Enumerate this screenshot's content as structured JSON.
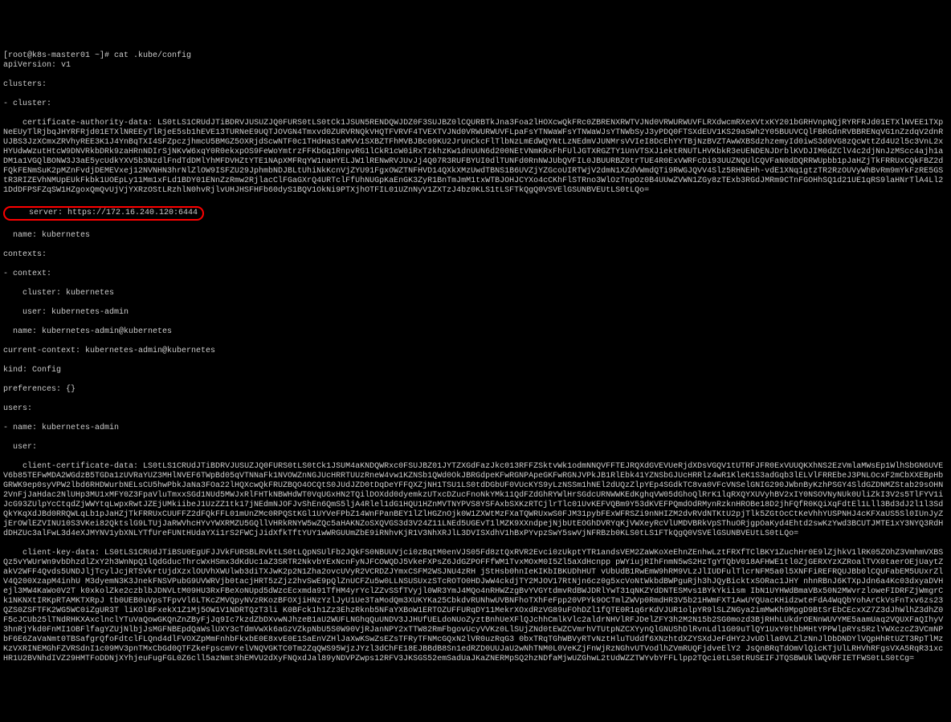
{
  "prompt": "[root@k8s-master01 ~]# ",
  "command": "cat .kube/config",
  "config": {
    "apiVersion": "apiVersion: v1",
    "clusters_header": "clusters:",
    "cluster_item": "- cluster:",
    "cert_auth_label": "    certificate-authority-data: ",
    "cert_auth_data": "LS0tLS1CRUdJTiBDRVJUSUZJQ0FURS0tLS0tCk1JSUN5RENDQWJDZ0F3SUJBZ0lCQURBTkJna3Foa2lHOXcwQkFRc0ZBRENXRWTVJNd0VRWURWUVFLRXdwcmRXeXVtxKY201bGRHVnpNQjRYRFRJd01ETXlNVEE1TXpNeEUyTlRjbqJHYRFRjd01ETXlNREEyTlRjeE5sb1hEVE13TURNeE9UQTJOVGN4Tmxvd0ZURVRNQkVHQTFVRVF4TVEXTVJNd0VRWURWUVFLpaFsYTNWaWFsYTNWaWJsYTNWbSyJ3yPDQ0FTSXdEUV1KS29aSWh2Y05BUUVCQlFBRGdnRVBBRENqVG1nZzdqV2dnRUJBS3JzXCmxZRVhyREE3K1J4YnBqTXI4SFZpczjhmcU5BMGZ5OXRjdScwNTF0c1THdHaStaMVV1SXBZTFhMVBJBc09KU2JrUnCkcFlTlbNzLmEdWQYNtLzNEdmVJUNMrsVVIeI8DcEhYYTBjNzBVZTAwWXBSdzhzemyId0iwS3d0VG8zQcWttZd4U2l5c3VnL2xHYUdwWzutHtcW9DNVRkbDRk9zaHRnNDIrSjNKvW6xqY0R0ekxpOS9FeWoYmtrzFFKbGq1RnpvRG1lCkR1cW0iRxTzkhzKw1dnUUN6d200NEtVNmKRxFhFUlJGTXRGZTY1UnVTSXJiektRNUTLHVKbkR3eUENDENJDrblKVDJIM0dZClV4c2djNnJzMScc4ajh1aDM1a1VGQlBONW3J3aE5ycUdkYXV5b3NzdlFndTdDMlYhMFDVHZtYTE1NApXMFRqYW1naHYELJW1lRENwRVJUvJj4Q07R3RUFBYUI0dlTUNFd0RnNWJUbQVFIL0JBUURBZ0trTUE4R0ExVWRFcDi93UUZNQUlCQVFaN0dDQRRWUpbb1pJaHZjTkFRRUxCQkFBZ2dFQkFENmSuK2pMZnFvdjDEMEVxej12NVNHN3hrNlZlOW9ISFZU29JphmbNDJBLtUhiNkKcnVjZYU91FgxOWZTNFHVD14QXkXMzUwdTBNS1B6UVZjYZGcoUIRTWjV2dmN1XZdVWmdQTi9RWGJQVV4Slz5RHNEHh-vdE1XNq1gtzTR2RzOUVyWhBvRm9mYkFzRE5GStR3RIZEVhNMUpEUkFkbk1UOEpLy11Mm1xFLd1BDY01ENnZzRmw2RjlacClFGaGXrQ4URTclFfUhNUGpKaEnGK3ZyR1BnTmJmM1txWTBJOHJCYXo4cCKhFlSTRno3WlOzTnpOz0B4UUwZVWN1ZGy8zTExb3RGdJMRm9CTnFGOHhSQ1d21UE1qRS9laHNrTlA4Ll21DdDFPSFZqSW1HZgoxQmQvUjVjYXRzOStLRzhlN0hvRjlvUHJHSFHFb60dyS1BQV1OkNi9PTXjhOTFIL01UZnNyV1ZXTzJ4bz0KLS1tLSFTkQgQ0VSVElGSUNBVEUtLS0tLQo=",
    "server_label": "    server: ",
    "server_value": "https://172.16.240.120:6444",
    "name_kubernetes": "  name: kubernetes",
    "contexts_header": "contexts:",
    "context_item": "- context:",
    "cluster_kubernetes": "    cluster: kubernetes",
    "user_admin": "    user: kubernetes-admin",
    "name_admin_ctx": "  name: kubernetes-admin@kubernetes",
    "current_context": "current-context: kubernetes-admin@kubernetes",
    "kind": "kind: Config",
    "preferences": "preferences: {}",
    "users_header": "users:",
    "user_item": "- name: kubernetes-admin",
    "user_sub": "  user:",
    "client_cert_label": "    client-certificate-data: ",
    "client_cert_data": "LS0tLS1CRUdJTiBDRVJUSUZJQ0FURS0tLS0tCk1JSUM4aKNDQWRxc0FSUJBZ01JYTZXGdFazJkc013RFFZSktvWk1odmNNQVFFTEJRQXdGVEVUeRjdXDsVGQV1tUTRFJFR0ExVUUQKXhNS2EzVmlaMWsEp1WlhSbGN6UVEV6b85TEFwMDA2WGdzB5TGDa1zUVRaYUZ3MHlNVEF6TWpBd05qVTNNaFk1NVOWZnNGJUcHRRTUUzRneW4vw1KZNSb1QWd0OkJBRGdpeKFwRGNPApeGKFwRGNJVPkJB1RlEbk41YZNSbGJUcHRRlz4wR1KleK1S3adGqb3lELVlFRREbeJ3PNLOcxF2mCbXXEBpHbGRWK9ep0syVPW2lbd6RHDWurbNELsCU5hwPbkJaNa3FOa22lHQXcwQkFRUZBQO4OCQtS0JUdJZD0tDqDeYFFQXZjNH1TSU1LS0tdDGbUF0VUcKYS9yLzNSSm1hNEl2dUQzZlpYEp4SGdkTC8va0VFcVNSelGNIG290JWbnByKzhPSGY4SldGZDNMZStab29sOHN2VnFjJaHdac2NlUHp3MU1xMFY0Z3FpaVluTmxxSGd1NUd5MWJxRlFHTkNBWHdWT0VqUGxHN2TQilDOXdd0dyemkzUTxcDZucFnoNkYMk11QdFZdGhRYWlHrSGdcURNWWKEdKghqVW05dGhoQlRrK1lqRXQYXUVyhBV2xIY0NSOVNyNUk0UliZkI3V2s5TlFYV1iJcG93ZUlpYcCtqdZjWWYtqLwpxRwtJZEjUMkiibeJ1UzZZ1tk17jNEdmNJOFJvShEn6QmS5ljA4Rlel1dG1HQU1HZnMVTNYPVS8YSFAxbSXKzRTCjlrTlc01UvKEFVQBm9Y53dKVEFPQmdOdRMynRzknHROBe18D2jhFQfR0KQiXqFdtEl1Lll3Bd3dJ2l1l3SdQkYKqXdJBd0RRQWLqLb1pJaHZjTkFRRUxCUUFFZ2dFQkFFL01mUnZMc0RPQStKGl1UYVeFPbZ14WnFPanBEY1lZlHGZnOjk0W1ZXWtMzFXaTQWRUxwS0FJM31pybFExWFRSZi9nNHIZM2dvRVdNTKtU2pjTlk5ZGtOcCtKeVhhYUSPNHJ4cKFXaUS5Sl0IUnJyZjErOWlEZVINU10S3VKei82QktslG9LTUjJaRWVhcHYvYWXRMZU5GQllVHRkRNYW5wZQc5aHAKNZoSXQVGS3d3V24Z11LNEd5UGEvT1lMZK9XXndpejNjbUtEOGhDVRYqKjVWXeyRcVlUMDVBRkVpSThuORjgpOaKyd4Ehtd2swKzYwd3BCUTJMTE1xY3NYQ3RdHdDHZUc3alFwL3d4eXJMYNV1ybXNLYTfUreFUNtHUdaYXi1rS2FWCjJidXfkTftYUY1wWRGUUmZbE9iRNhvKjR1V3NhXRJlL3DVISXdhV1hBxPYvpzSwY5swVjNFRBzb0KLS0tLS1FTkQgQ0VSVElGSUNBVEUtLS0tLQo=",
    "client_key_label": "    client-key-data: ",
    "client_key_data": "LS0tLS1CRUdJTiBSU0EgUFJJVkFURSBLRVktLS0tLQpNSUlFb2JQkFS0NBUUVjci0zBqtM0enVJS05Fd8ztQxRVR2Evci0zUkptYTR1andsVEM2ZaWKoXeEhnZEnhwLztFRXfTClBKY1ZuchHr0E9lZjhkV1lRK05ZOhZ3VmhmVXBSQz5vYWUrWn9vbDhzdlZxY2h3WnNpQ1lQdGducThrcWxHSmx3dKdUc1aZ3SRTR2NkvbYExNcnFyNJFCOWQDJ5VkeFXPsZ6JdGZPOFFfWM1TvxMOxM0I5Zl5aXdHcnpp pWYiujRIhFnmN5wS2HzTgYTQbV018AFHWE1tl0ZjGERXYzXZRoalTVX0taerOEjUaytZakV2WFF4Qvds5UNDJljTcylJcjRTSVkrtUjdXzxlOUVhXWUlwb3diTXJwK2p2N1Zha2ovcUVyR2VCRDZJYmxCSFM2WSJNU4zRH jStHsb0hnIeKIKbIBKUDhHUT vUbUdB1RwEmW9hRM9VLzJlIUDFulTlcrNFM5a0l5XNFFiREFRQUJBb0lCQUFabEM5UUxrZlV4Q200XzapM4inhU M3dyemN3K3JnekFNSVPubG9UVWRVjb0tacjHRT5zZjz2hvSwE9pQlZnUCFZu5w0LLNSUSUxzSTcROTO0HDJwW4ckdjTY2MJOV17RtNjn6cz0g5xcVoNtWkbdBWPguRjh3hJQyBicktxSORac1JHY nhnRBnJ6KTXpJdn6a4Kc03dxyaDVHejl3MW4KaWo0V2T k0xkolZke2czblbJDNVLtM09HU3RxFBeXoNUpd5dWzcEcxmda91TfHM4yrYclZZvSSfTVyjl0WR3YmJ4MQo4nRHWZzgBvYVGYtdmvRdBWJDRlYwT31qNKZYdDNTESMvs1BYkYkiism IbN1UYHWdBmaVBx50N2MWvrzloweFIDRFZjWmgrCk1NKNXtIRKpRTAMKTXRpJ tb0UEB0uVpsTFpvVl6LTKcZMVQpyNVzRKozBFOXjiHNzYzlJyU1Ue3TaModQm3XUKYKa25CbkdvRUNhwUVBNFhoTXhFeFpp20VPYk9OCTmlZWVp0RmdHR3V5b21HWmFXT1AwUYQUacKHidzwteFdA4WqQbYohArCkVsFnTxv6zs23QZS0ZSFTFK2WG5WC0iZgUR3T liKOlBFxekX1Z1Mj5OW1V1NDRTQzT3li K0BFck1h1Zz3EhzRknb5NFaYXBoW1ERTOZUFFURqDY11MekrXOxdRzVG89uFOhDZl1fQTE0R1q6rKdVJUR1olpYR9lSLZNGya2imMwKh9MpgD9BtSrEbCEcxXZ7Z3dJhWlhZ3dhZ0F5cJCUb25lTNdRHKXAxclnclYTuVaQowGKQnZnZByFjJq9Ic7kzdZbDXvwNJhzeB1aU2WUFLNGhqQuUNDV3JJHUfUELdoNUoZyztBnhUeXFlQJchhCmlkVlc2aldrNHVlRFJDelZFY3h2M2N15b2SG0mozd3BjRHhLUkdrOENnWUVYME5aamUaq2VQUXFaQIhyV3hnRjYkd0FnMI1OBFlfagYZUjNlbjJsMGFNBEpdQaWslUXY3cTdmVwXk6aGzVZkpNbU5S0W90VjRJanNPY2xTTW82RmFbgovUcyVVKz0LlSUjZNd0tEWZCVmrhVTUtpNZCXYynQlGNUShDlRvnLdl1G09uTlQY1UxY0thbMHtYPPWlpRYs5RzlYWXczcZ3VCmNPbF6E6ZaVaNmt0TBSafgrQfoFdtclFLQnd4dlFVOXZpMmFnhbFkxbE0E8xvE0E1SaEnVZHlJaXwKSwZsEZsTFRyTFNMcGQxN2lVR0uzRqG3 0bxTRqTGhWBVyRTvNztHluTUddf6XNzhtdXZYSXdJeFdHY2JvUDlla0VLZlzNnJlDbDNDYlVQpHhRtUZT3RpTlMzKzVXRINEMGhFZVRSdnI1c09MV3pnTMxCbGd0QTFZkeFpscmVrelVNQVGKTC0Tm2ZqQWS95WjzJYzl3dChFE18EJBBdB8Sn1edRZD0UUJaU2wNhTNM0L0VeKZjFnWjRzNGhvUTVodlhZVmRUQFjdveElY2 JsQnBRqTdOmVlQicKTjUlLRHVhRFgsVXA5RqR31xcHR1U2BVNhdIVZ29HMTFoDDNjXYhjeuFugFGL0Z6cll5azNmt3hEMVU2dXyFNQxdJal89yNDVPZwps12RFV3JKSGS52emSadUaJKaZNERMpSQ2hzNDfaMjwUZGhwL2tUdWZZTWYvbYFFLlpp2TQci0tLS0tRUSEIFJTQSBWUklWQVRFIETFWS0tLS0tCg="
  }
}
